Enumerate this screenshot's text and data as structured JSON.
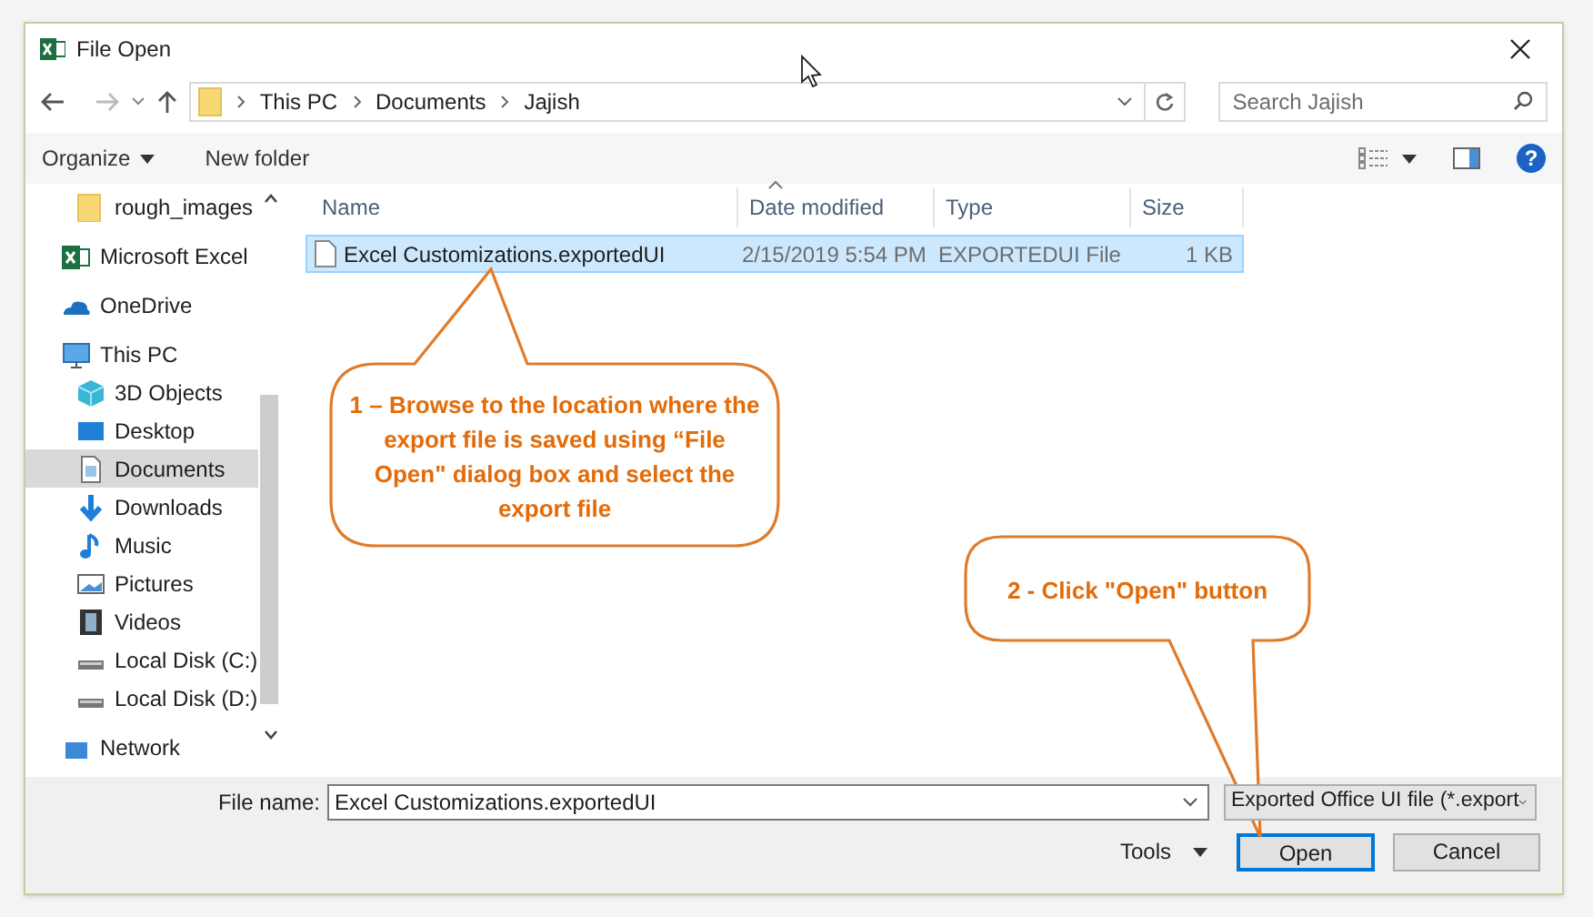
{
  "window": {
    "title": "File Open"
  },
  "address_bar": {
    "crumbs": [
      "This PC",
      "Documents",
      "Jajish"
    ]
  },
  "search": {
    "placeholder": "Search Jajish"
  },
  "toolbar": {
    "organize": "Organize",
    "new_folder": "New folder",
    "help": "?"
  },
  "sidebar": {
    "items": [
      {
        "label": "rough_images",
        "kind": "folder",
        "selected": false
      },
      {
        "label": "Microsoft Excel",
        "kind": "excel",
        "selected": false
      },
      {
        "label": "OneDrive",
        "kind": "onedrive",
        "selected": false
      },
      {
        "label": "This PC",
        "kind": "pc",
        "selected": false,
        "children": [
          {
            "label": "3D Objects",
            "kind": "objects3d",
            "selected": false
          },
          {
            "label": "Desktop",
            "kind": "desktop",
            "selected": false
          },
          {
            "label": "Documents",
            "kind": "documents",
            "selected": true
          },
          {
            "label": "Downloads",
            "kind": "downloads",
            "selected": false
          },
          {
            "label": "Music",
            "kind": "music",
            "selected": false
          },
          {
            "label": "Pictures",
            "kind": "pictures",
            "selected": false
          },
          {
            "label": "Videos",
            "kind": "videos",
            "selected": false
          },
          {
            "label": "Local Disk (C:)",
            "kind": "disk",
            "selected": false
          },
          {
            "label": "Local Disk (D:)",
            "kind": "disk",
            "selected": false
          }
        ]
      },
      {
        "label": "Network",
        "kind": "network",
        "selected": false
      }
    ]
  },
  "table": {
    "columns": [
      "Name",
      "Date modified",
      "Type",
      "Size"
    ],
    "rows": [
      {
        "cells": [
          "Excel Customizations.exportedUI",
          "2/15/2019 5:54 PM",
          "EXPORTEDUI File",
          "1 KB"
        ],
        "selected": true
      }
    ]
  },
  "footer": {
    "file_name_label": "File name:",
    "file_name_value": "Excel Customizations.exportedUI",
    "file_type": "Exported Office UI file (*.export",
    "tools": "Tools",
    "open": "Open",
    "cancel": "Cancel"
  },
  "callouts": [
    {
      "text": "1 – Browse to the location where the export file is saved using “File Open\" dialog box and select the export file"
    },
    {
      "text": "2 - Click \"Open\" button"
    }
  ]
}
